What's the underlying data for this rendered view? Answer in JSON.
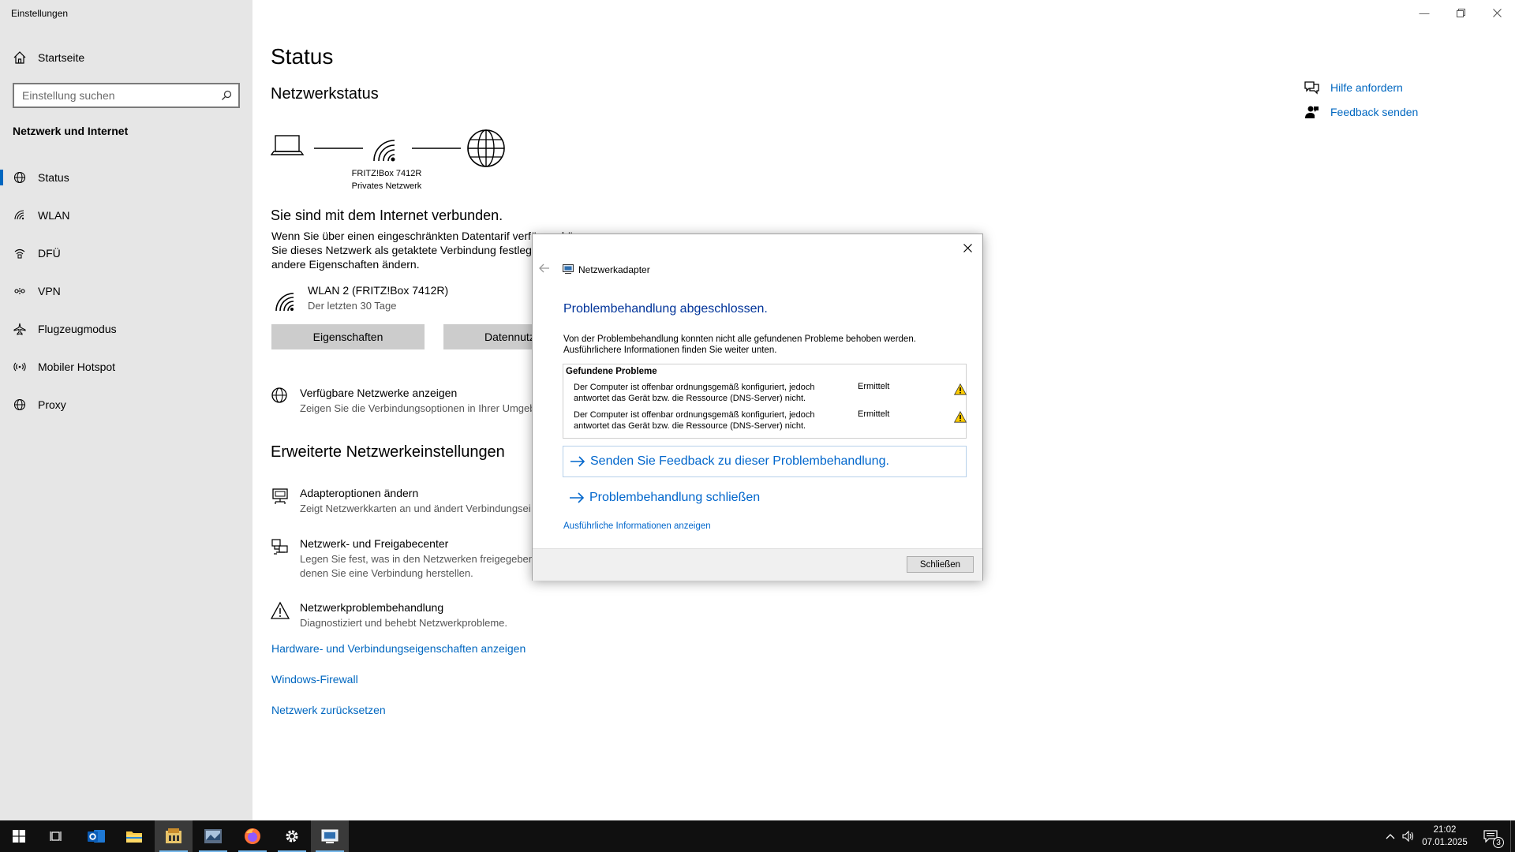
{
  "window": {
    "title": "Einstellungen",
    "minimize_icon": "minimize-icon",
    "restore_icon": "restore-icon",
    "close_icon": "close-icon"
  },
  "sidebar": {
    "home_label": "Startseite",
    "search_placeholder": "Einstellung suchen",
    "section_title": "Netzwerk und Internet",
    "items": [
      {
        "label": "Status",
        "icon": "globe-icon",
        "active": true
      },
      {
        "label": "WLAN",
        "icon": "wifi-icon",
        "active": false
      },
      {
        "label": "DFÜ",
        "icon": "dialup-icon",
        "active": false
      },
      {
        "label": "VPN",
        "icon": "vpn-icon",
        "active": false
      },
      {
        "label": "Flugzeugmodus",
        "icon": "airplane-icon",
        "active": false
      },
      {
        "label": "Mobiler Hotspot",
        "icon": "hotspot-icon",
        "active": false
      },
      {
        "label": "Proxy",
        "icon": "globe-icon",
        "active": false
      }
    ]
  },
  "main": {
    "page_title": "Status",
    "network_status_heading": "Netzwerkstatus",
    "router_name": "FRITZ!Box 7412R",
    "network_type": "Privates Netzwerk",
    "connected_text": "Sie sind mit dem Internet verbunden.",
    "metered_paragraph_line1": "Wenn Sie über einen eingeschränkten Datentarif verfügen, können",
    "metered_paragraph_line2": "Sie dieses Netzwerk als getaktete Verbindung festlege",
    "metered_paragraph_line3": "andere Eigenschaften ändern.",
    "wlan_name": "WLAN 2 (FRITZ!Box 7412R)",
    "wlan_sub": "Der letzten 30 Tage",
    "properties_button": "Eigenschaften",
    "data_usage_button": "Datennutz",
    "available_networks": {
      "title": "Verfügbare Netzwerke anzeigen",
      "desc": "Zeigen Sie die Verbindungsoptionen in Ihrer Umgeb"
    },
    "advanced_heading": "Erweiterte Netzwerkeinstellungen",
    "adapter_options": {
      "title": "Adapteroptionen ändern",
      "desc": "Zeigt Netzwerkkarten an und ändert Verbindungsei"
    },
    "sharing_center": {
      "title": "Netzwerk- und Freigabecenter",
      "desc_line1": "Legen Sie fest, was in den Netzwerken freigegeben",
      "desc_line2": "denen Sie eine Verbindung herstellen."
    },
    "troubleshooter": {
      "title": "Netzwerkproblembehandlung",
      "desc": "Diagnostiziert und behebt Netzwerkprobleme."
    },
    "links": [
      "Hardware- und Verbindungseigenschaften anzeigen",
      "Windows-Firewall",
      "Netzwerk zurücksetzen"
    ]
  },
  "help": {
    "get_help": "Hilfe anfordern",
    "feedback": "Feedback senden"
  },
  "dialog": {
    "title": "Netzwerkadapter",
    "heading": "Problembehandlung abgeschlossen.",
    "text_line1": "Von der Problembehandlung konnten nicht alle gefundenen Probleme behoben werden.",
    "text_line2": "Ausführlichere Informationen finden Sie weiter unten.",
    "problems_title": "Gefundene Probleme",
    "problems": [
      {
        "line1": "Der Computer ist offenbar ordnungsgemäß konfiguriert, jedoch",
        "line2": "antwortet das Gerät bzw. die Ressource (DNS-Server) nicht.",
        "status": "Ermittelt"
      },
      {
        "line1": "Der Computer ist offenbar ordnungsgemäß konfiguriert, jedoch",
        "line2": "antwortet das Gerät bzw. die Ressource (DNS-Server) nicht.",
        "status": "Ermittelt"
      }
    ],
    "feedback_action": "Senden Sie Feedback zu dieser Problembehandlung.",
    "close_action": "Problembehandlung schließen",
    "detail_link": "Ausführliche Informationen anzeigen",
    "close_button": "Schließen"
  },
  "taskbar": {
    "time": "21:02",
    "date": "07.01.2025",
    "notification_count": "3"
  },
  "colors": {
    "accent": "#0067c0",
    "sidebar_bg": "#e6e6e6",
    "dialog_heading": "#003399",
    "taskbar_bg": "#101010"
  }
}
